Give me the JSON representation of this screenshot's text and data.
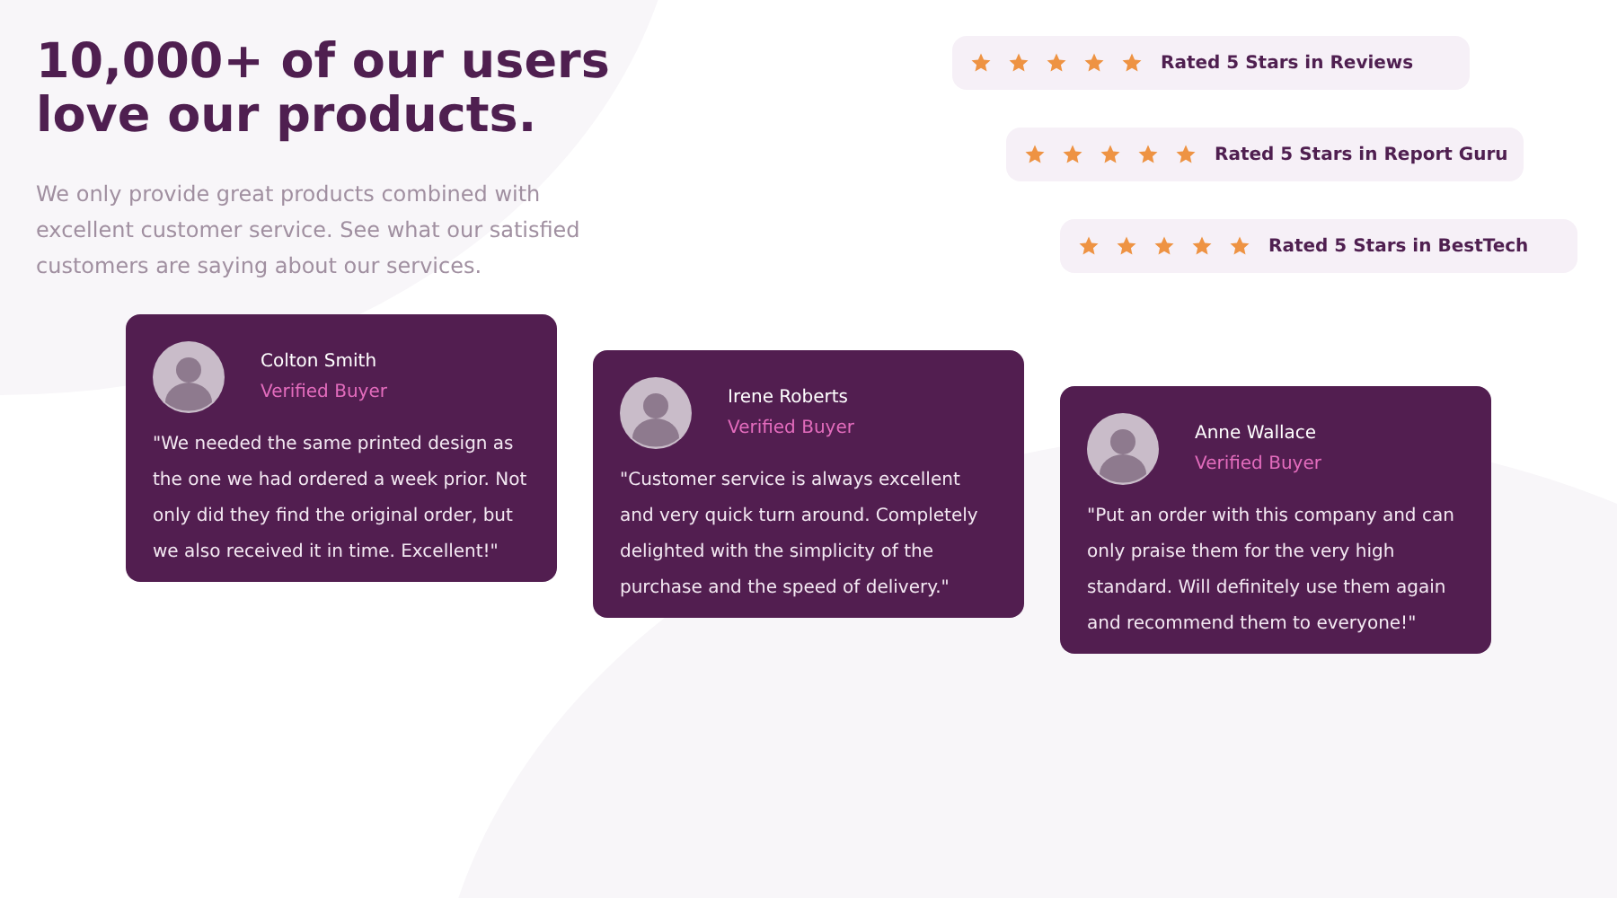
{
  "header": {
    "title_lines": [
      "10,000+ of our users",
      "love our products."
    ],
    "description": "We only provide great products combined with excellent customer service. See what our satisfied customers are saying about our services."
  },
  "ratings": [
    {
      "stars": 5,
      "label": "Rated 5 Stars in Reviews"
    },
    {
      "stars": 5,
      "label": "Rated 5 Stars in Report Guru"
    },
    {
      "stars": 5,
      "label": "Rated 5 Stars in BestTech"
    }
  ],
  "testimonials": [
    {
      "name": "Colton Smith",
      "badge": "Verified Buyer",
      "quote": "\"We needed the same printed design as the one we had ordered a week prior. Not only did they find the original order, but we also received it in time. Excellent!\""
    },
    {
      "name": "Irene Roberts",
      "badge": "Verified Buyer",
      "quote": "\"Customer service is always excellent and very quick turn around. Completely delighted with the simplicity of the purchase and the speed of delivery.\""
    },
    {
      "name": "Anne Wallace",
      "badge": "Verified Buyer",
      "quote": "\"Put an order with this company and can only praise them for the very high standard. Will definitely use them again and recommend them to everyone!\""
    }
  ]
}
